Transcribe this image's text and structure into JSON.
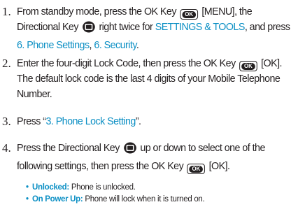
{
  "steps": [
    {
      "number": "1.",
      "parts": {
        "a": "From standby mode, press the OK Key",
        "b": "[MENU], the Directional",
        "c": "Key",
        "d": "right twice for",
        "e": "SETTINGS & TOOLS",
        "f": ", and press",
        "g": "6. Phone Settings",
        "h": ",",
        "i": "6. Security",
        "j": "."
      }
    },
    {
      "number": "2.",
      "parts": {
        "a": "Enter the four-digit Lock Code, then press the OK Key",
        "b": "[OK]. The default lock code is the last 4 digits of your Mobile Telephone Number."
      }
    },
    {
      "number": "3.",
      "parts": {
        "a": "Press “",
        "b": "3. Phone Lock Setting",
        "c": "”."
      }
    },
    {
      "number": "4.",
      "parts": {
        "a": "Press the Directional Key",
        "b": "up or down to select one of the following settings, then press the OK Key",
        "c": "[OK]."
      }
    }
  ],
  "ok_key_label": "OK",
  "bullets": [
    {
      "term": "Unlocked:",
      "desc": "Phone is unlocked."
    },
    {
      "term": "On Power Up:",
      "desc": "Phone will lock when it is turned on."
    }
  ],
  "colors": {
    "accent": "#0b8fc4",
    "text": "#231f20"
  },
  "icons": [
    "ok-key-icon",
    "directional-key-icon",
    "bullet-dot"
  ]
}
